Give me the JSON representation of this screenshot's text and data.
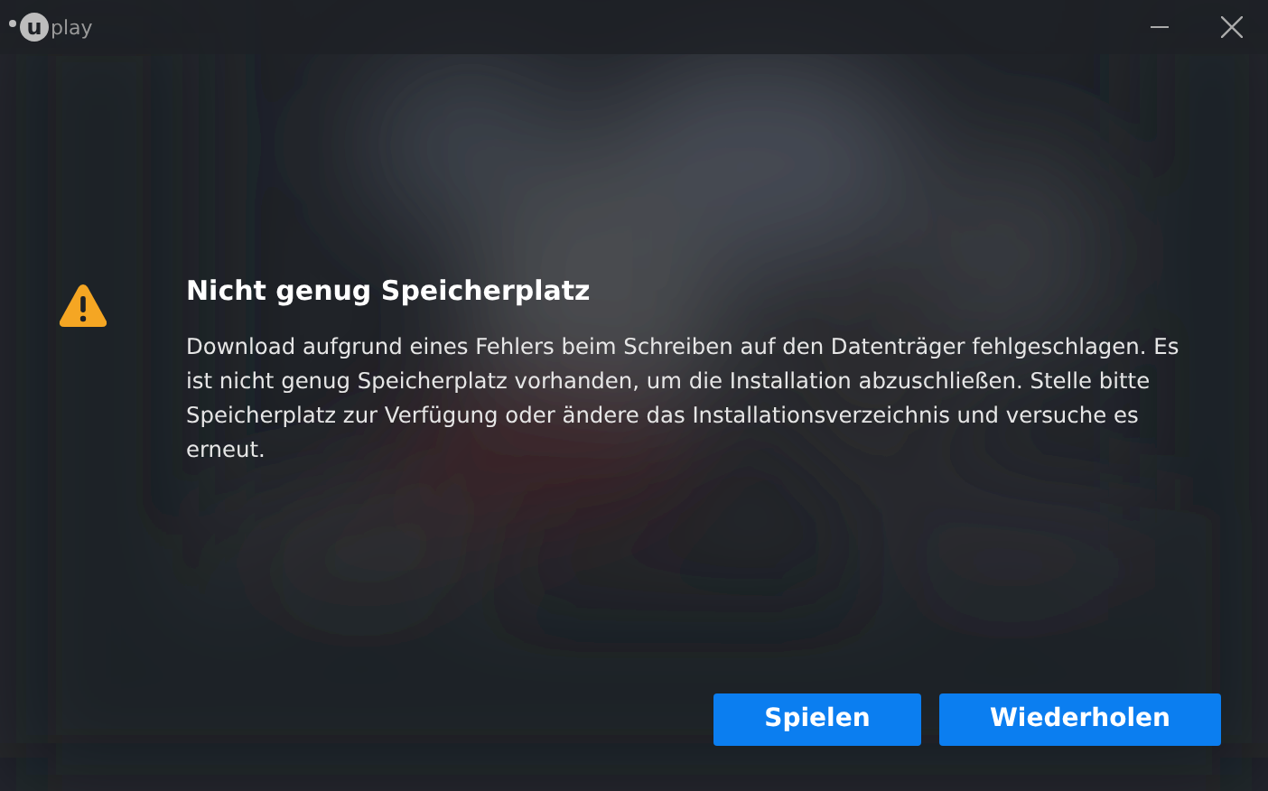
{
  "window": {
    "logo": {
      "mark": "u",
      "word": "play"
    }
  },
  "dialog": {
    "title": "Nicht genug Speicherplatz",
    "message": "Download aufgrund eines Fehlers beim Schreiben auf den Datenträger fehlgeschlagen. Es ist nicht genug Speicherplatz vorhanden, um die Installation abzuschließen. Stelle bitte Speicherplatz zur Verfügung oder ändere das Installationsverzeichnis und versuche es erneut."
  },
  "buttons": [
    {
      "label": "Spielen"
    },
    {
      "label": "Wiederholen"
    }
  ]
}
